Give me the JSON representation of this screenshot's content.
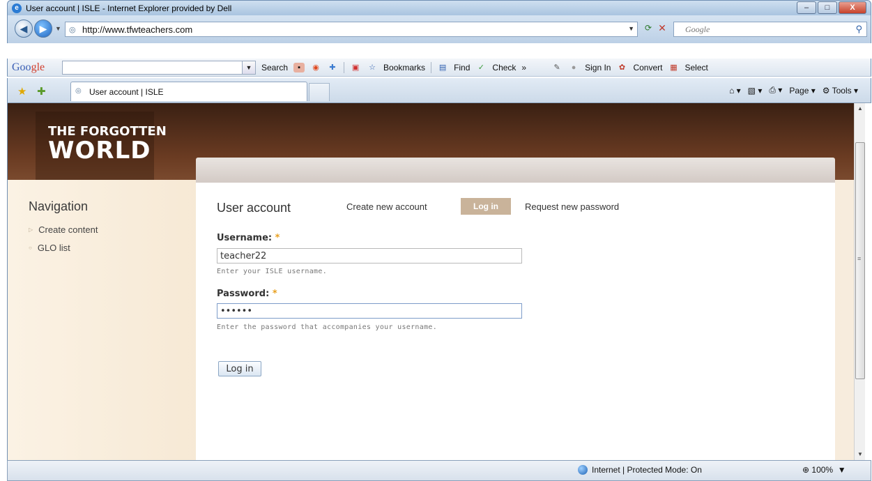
{
  "window": {
    "title": "User account | ISLE - Internet Explorer provided by Dell",
    "min_label": "–",
    "max_label": "□",
    "close_label": "X"
  },
  "address_bar": {
    "url": "http://www.tfwteachers.com",
    "search_placeholder": "Google"
  },
  "google_toolbar": {
    "logo_prefix": "Goo",
    "logo_suffix": "gle",
    "search_label": "Search",
    "bookmarks_label": "Bookmarks",
    "find_label": "Find",
    "check_label": "Check",
    "more_label": "»",
    "sign_in_label": "Sign In",
    "convert_label": "Convert",
    "select_label": "Select"
  },
  "tabs": [
    {
      "label": "User account | ISLE"
    }
  ],
  "command_bar": {
    "page_label": "Page",
    "tools_label": "Tools"
  },
  "site": {
    "logo_top": "THE FORGOTTEN",
    "logo_bottom": "WORLD"
  },
  "sidebar": {
    "title": "Navigation",
    "items": [
      {
        "label": "Create content"
      },
      {
        "label": "GLO list"
      }
    ]
  },
  "main": {
    "title": "User account",
    "tabs": [
      {
        "label": "Create new account"
      },
      {
        "label": "Log in"
      },
      {
        "label": "Request new password"
      }
    ],
    "username_label": "Username:",
    "username_value": "teacher22",
    "username_hint": "Enter your ISLE username.",
    "password_label": "Password:",
    "password_value": "••••••",
    "password_hint": "Enter the password that accompanies your username.",
    "required_mark": "*",
    "submit_label": "Log in"
  },
  "status_bar": {
    "zone": "Internet | Protected Mode: On",
    "zoom": "100%"
  }
}
